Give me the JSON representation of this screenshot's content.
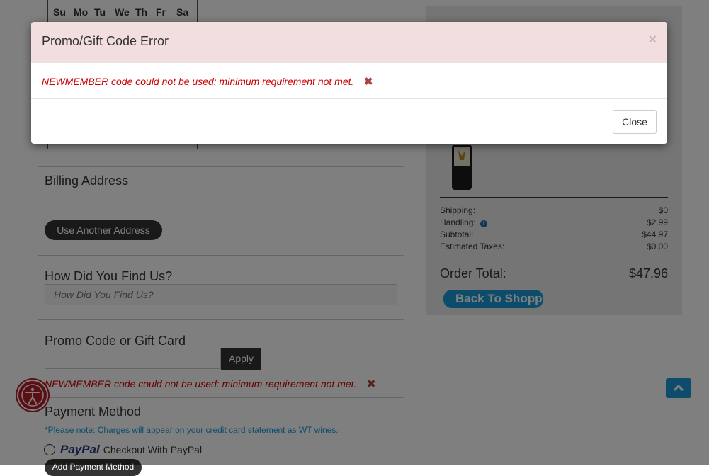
{
  "calendar": {
    "days": [
      "Su",
      "Mo",
      "Tu",
      "We",
      "Th",
      "Fr",
      "Sa"
    ]
  },
  "billing": {
    "title": "Billing Address",
    "use_another_label": "Use Another Address"
  },
  "find_us": {
    "title": "How Did You Find Us?",
    "placeholder": "How Did You Find Us?"
  },
  "promo": {
    "title": "Promo Code or Gift Card",
    "apply_label": "Apply",
    "error": "NEWMEMBER code could not be used: minimum requirement not met."
  },
  "payment": {
    "title": "Payment Method",
    "note": "*Please note: Charges will appear on your credit card statement as WT wines.",
    "paypal_logo": "PayPal",
    "paypal_label": "Checkout With PayPal",
    "add_payment_label": "Add Payment Method"
  },
  "summary": {
    "rows": [
      {
        "label": "Shipping:",
        "value": "$0"
      },
      {
        "label": "Handling:",
        "value": "$2.99"
      },
      {
        "label": "Subtotal:",
        "value": "$44.97"
      },
      {
        "label": "Estimated Taxes:",
        "value": "$0.00"
      }
    ],
    "order_total_label": "Order Total:",
    "order_total_value": "$47.96",
    "back_label": "Back To Shopping"
  },
  "modal": {
    "title": "Promo/Gift Code Error",
    "message": "NEWMEMBER code could not be used: minimum requirement not met.",
    "close_label": "Close"
  },
  "icons": {
    "accessibility": "accessibility-icon",
    "scroll_top": "chevron-up-icon",
    "info": "info-icon",
    "remove": "remove-icon",
    "close": "close-icon"
  },
  "colors": {
    "error": "#cc0000",
    "accent": "#1a9ad6",
    "dark_button": "#333333",
    "modal_header": "#f2dede"
  }
}
